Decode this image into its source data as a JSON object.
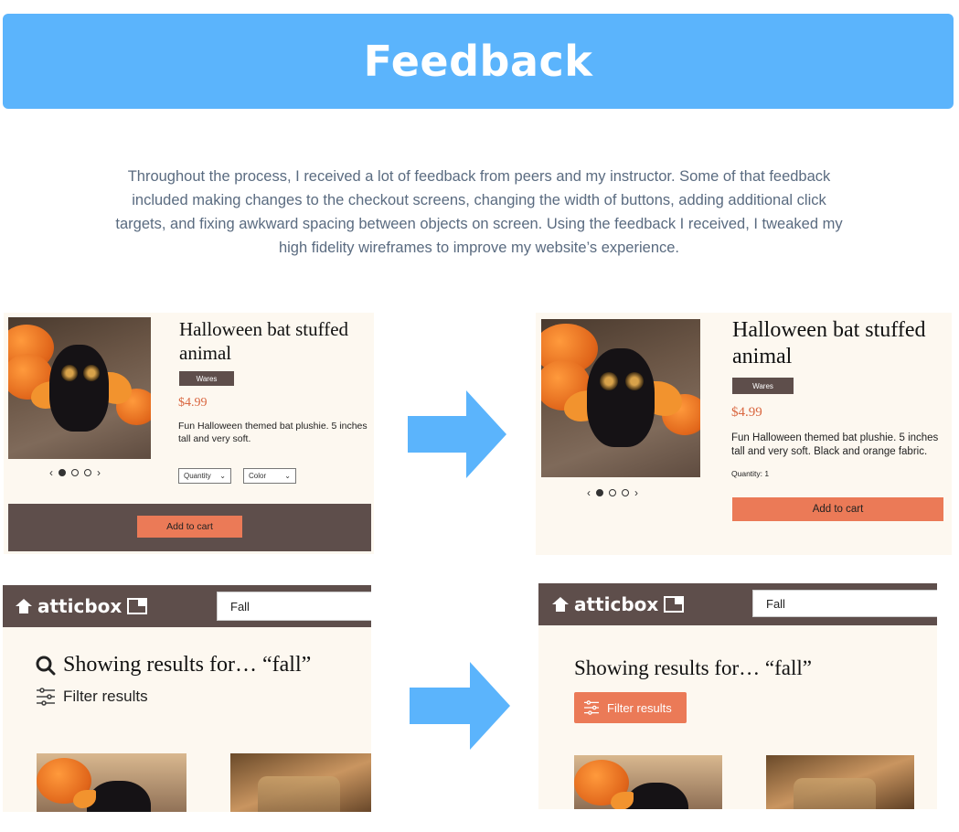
{
  "banner": {
    "title": "Feedback"
  },
  "intro": "Throughout the process, I received a lot of feedback from peers and my instructor. Some of that feedback included making changes to the checkout screens, changing the width of buttons, adding additional click targets, and fixing awkward spacing between objects on screen. Using the feedback I received, I tweaked my high fidelity wireframes to improve my website’s experience.",
  "product_before": {
    "title": "Halloween bat stuffed animal",
    "tag": "Wares",
    "price": "$4.99",
    "description": "Fun Halloween themed bat plushie. 5 inches tall and very soft.",
    "quantity_label": "Quantity",
    "color_label": "Color",
    "cta": "Add to cart"
  },
  "product_after": {
    "title": "Halloween bat stuffed animal",
    "tag": "Wares",
    "price": "$4.99",
    "description": "Fun Halloween themed bat plushie. 5 inches tall and very soft. Black and orange fabric.",
    "quantity": "Quantity: 1",
    "cta": "Add to cart"
  },
  "search_before": {
    "logo": "atticbox",
    "search_value": "Fall",
    "heading": "Showing results for… “fall”",
    "filter_label": "Filter results"
  },
  "search_after": {
    "logo": "atticbox",
    "search_value": "Fall",
    "heading": "Showing results for… “fall”",
    "filter_label": "Filter results"
  },
  "colors": {
    "banner": "#5bb4fc",
    "arrow": "#5bb4fc",
    "brand_dark": "#5e4e4b",
    "accent": "#eb7a57",
    "panel_bg": "#fdf8f0"
  },
  "icons": [
    "home-icon",
    "box-icon",
    "search-icon",
    "sliders-icon",
    "arrow-right-icon",
    "chevron-left-icon",
    "chevron-right-icon",
    "chevron-down-icon"
  ]
}
